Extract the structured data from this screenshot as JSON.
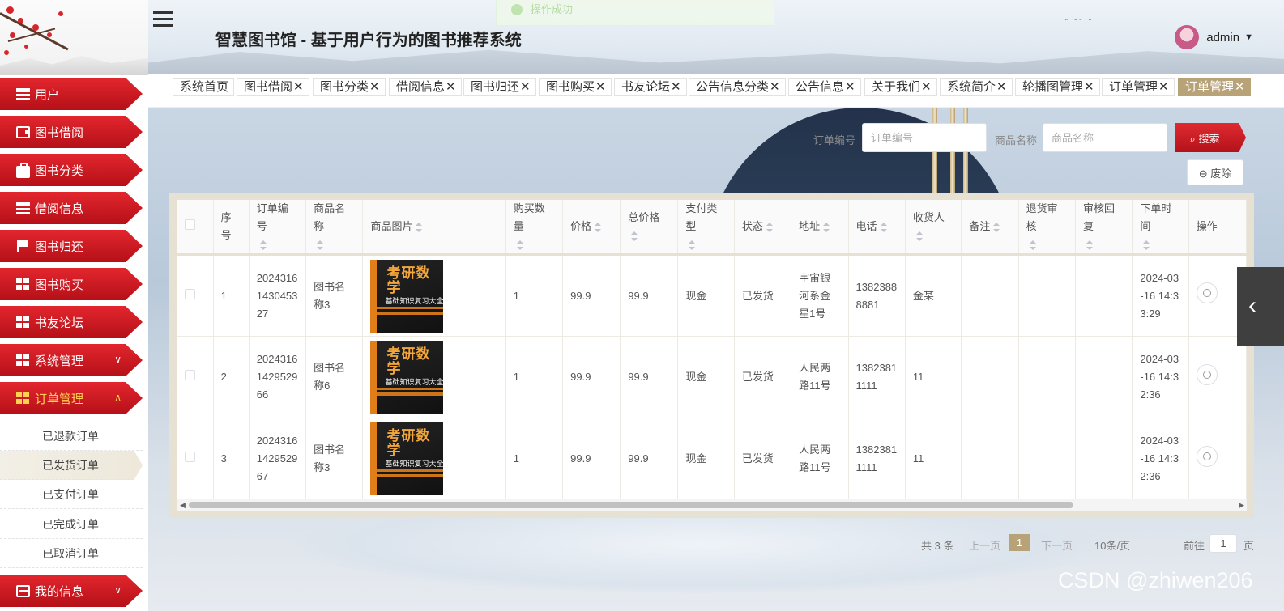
{
  "app": {
    "title": "智慧图书馆 - 基于用户行为的图书推荐系统"
  },
  "toast": "操作成功",
  "user": {
    "name": "admin"
  },
  "sidebar": {
    "items": [
      {
        "label": "用户",
        "icon": "list-icon"
      },
      {
        "label": "图书借阅",
        "icon": "wallet-icon"
      },
      {
        "label": "图书分类",
        "icon": "briefcase-icon"
      },
      {
        "label": "借阅信息",
        "icon": "list-icon"
      },
      {
        "label": "图书归还",
        "icon": "flag-icon"
      },
      {
        "label": "图书购买",
        "icon": "grid-icon"
      },
      {
        "label": "书友论坛",
        "icon": "grid-icon"
      },
      {
        "label": "系统管理",
        "icon": "grid-icon"
      },
      {
        "label": "订单管理",
        "icon": "grid-icon"
      },
      {
        "label": "我的信息",
        "icon": "card-icon"
      }
    ],
    "subitems": [
      "已退款订单",
      "已发货订单",
      "已支付订单",
      "已完成订单",
      "已取消订单"
    ]
  },
  "tabs": [
    "系统首页",
    "图书借阅",
    "图书分类",
    "借阅信息",
    "图书归还",
    "图书购买",
    "书友论坛",
    "公告信息分类",
    "公告信息",
    "关于我们",
    "系统简介",
    "轮播图管理",
    "订单管理",
    "订单管理"
  ],
  "search": {
    "order_label": "订单编号",
    "order_placeholder": "订单编号",
    "product_label": "商品名称",
    "product_placeholder": "商品名称",
    "search_button": "搜索",
    "delete_button": "废除"
  },
  "table": {
    "headers": [
      "序号",
      "订单编号",
      "商品名称",
      "商品图片",
      "购买数量",
      "价格",
      "总价格",
      "支付类型",
      "状态",
      "地址",
      "电话",
      "收货人",
      "备注",
      "退货审核",
      "审核回复",
      "下单时间",
      "操作"
    ],
    "book_cover": {
      "title": "考研数学",
      "subtitle": "基础知识复习大全"
    },
    "rows": [
      {
        "no": "1",
        "order_no": "2024316143045327",
        "product": "图书名称3",
        "qty": "1",
        "price": "99.9",
        "total": "99.9",
        "pay_type": "现金",
        "status": "已发货",
        "address": "宇宙银河系金星1号",
        "phone": "13823888881",
        "receiver": "金某",
        "remark": "",
        "return_review": "",
        "review_reply": "",
        "time": "2024-03-16 14:33:29"
      },
      {
        "no": "2",
        "order_no": "2024316142952966",
        "product": "图书名称6",
        "qty": "1",
        "price": "99.9",
        "total": "99.9",
        "pay_type": "现金",
        "status": "已发货",
        "address": "人民两路11号",
        "phone": "13823811111",
        "receiver": "11",
        "remark": "",
        "return_review": "",
        "review_reply": "",
        "time": "2024-03-16 14:32:36"
      },
      {
        "no": "3",
        "order_no": "2024316142952967",
        "product": "图书名称3",
        "qty": "1",
        "price": "99.9",
        "total": "99.9",
        "pay_type": "现金",
        "status": "已发货",
        "address": "人民两路11号",
        "phone": "13823811111",
        "receiver": "11",
        "remark": "",
        "return_review": "",
        "review_reply": "",
        "time": "2024-03-16 14:32:36"
      }
    ]
  },
  "pagination": {
    "total": "共 3 条",
    "prev": "上一页",
    "current": "1",
    "next": "下一页",
    "page_size": "10条/页",
    "goto_label": "前往",
    "goto_value": "1",
    "goto_suffix": "页"
  },
  "watermark": "CSDN @zhiwen206"
}
